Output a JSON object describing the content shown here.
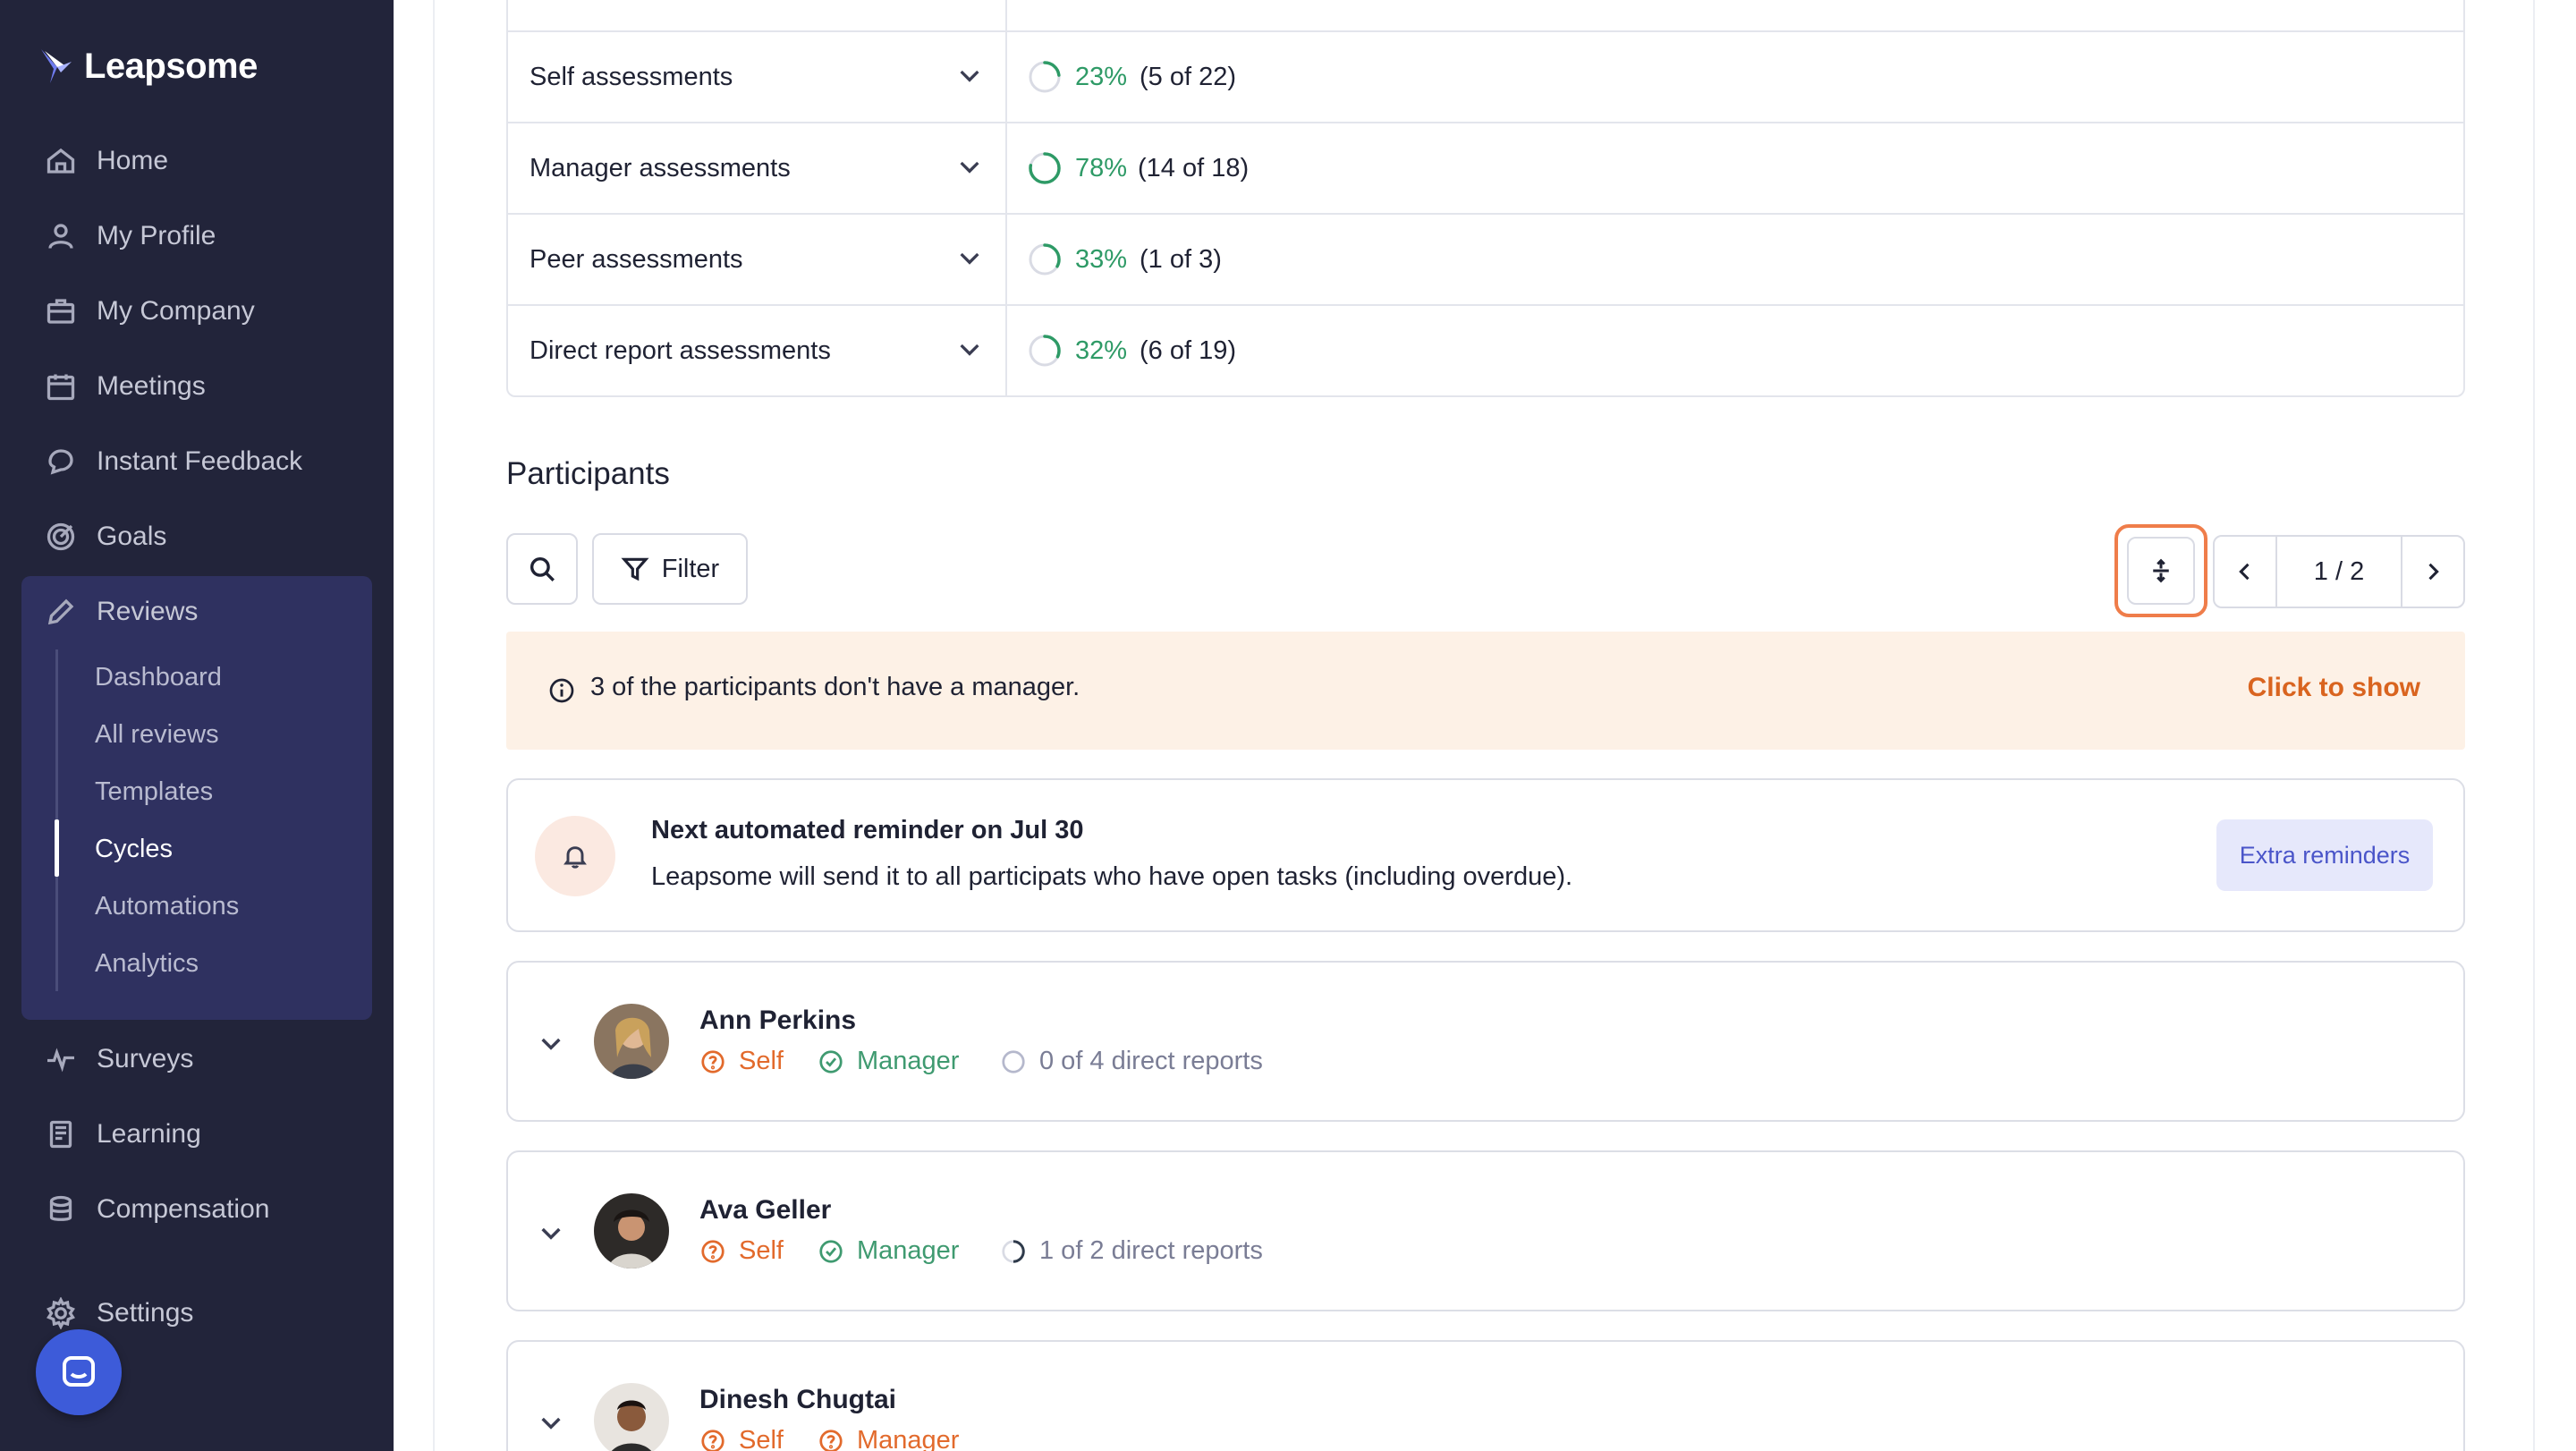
{
  "brand": {
    "name": "Leapsome"
  },
  "nav": {
    "items": [
      {
        "label": "Home",
        "icon": "home-icon"
      },
      {
        "label": "My Profile",
        "icon": "user-icon"
      },
      {
        "label": "My Company",
        "icon": "briefcase-icon"
      },
      {
        "label": "Meetings",
        "icon": "calendar-icon"
      },
      {
        "label": "Instant Feedback",
        "icon": "chat-icon"
      },
      {
        "label": "Goals",
        "icon": "target-icon"
      },
      {
        "label": "Reviews",
        "icon": "pencil-icon"
      }
    ],
    "reviews_sub": [
      "Dashboard",
      "All reviews",
      "Templates",
      "Cycles",
      "Automations",
      "Analytics"
    ],
    "active_sub": "Cycles",
    "bottom_items": [
      {
        "label": "Surveys",
        "icon": "pulse-icon"
      },
      {
        "label": "Learning",
        "icon": "book-icon"
      },
      {
        "label": "Compensation",
        "icon": "coins-icon"
      },
      {
        "label": "Settings",
        "icon": "gear-icon"
      }
    ]
  },
  "scopes": [
    {
      "name": "Self assessments",
      "percent": "23%",
      "count": "(5 of 22)",
      "fraction": 0.23
    },
    {
      "name": "Manager assessments",
      "percent": "78%",
      "count": "(14 of 18)",
      "fraction": 0.78
    },
    {
      "name": "Peer assessments",
      "percent": "33%",
      "count": "(1 of 3)",
      "fraction": 0.33
    },
    {
      "name": "Direct report assessments",
      "percent": "32%",
      "count": "(6 of 19)",
      "fraction": 0.32
    }
  ],
  "participants": {
    "title": "Participants",
    "filter_label": "Filter",
    "pager": "1 / 2",
    "alert_text": "3 of the participants don't have a manager.",
    "alert_link": "Click to show",
    "reminder": {
      "title": "Next automated reminder on Jul 30",
      "subtitle": "Leapsome will send it to all participats who have open tasks (including overdue).",
      "button": "Extra reminders"
    },
    "people": [
      {
        "name": "Ann Perkins",
        "self": "Self",
        "manager": "Manager",
        "reports": "0 of 4 direct reports"
      },
      {
        "name": "Ava Geller",
        "self": "Self",
        "manager": "Manager",
        "reports": "1 of 2 direct reports"
      },
      {
        "name": "Dinesh Chugtai",
        "self": "Self",
        "manager": "Manager",
        "reports": ""
      }
    ]
  },
  "colors": {
    "sidebar_bg": "#22243a",
    "accent_green": "#2e9a66",
    "accent_orange": "#e26a2c",
    "alert_bg": "#fdf1e6",
    "highlight_ring": "#ef7d4a"
  }
}
